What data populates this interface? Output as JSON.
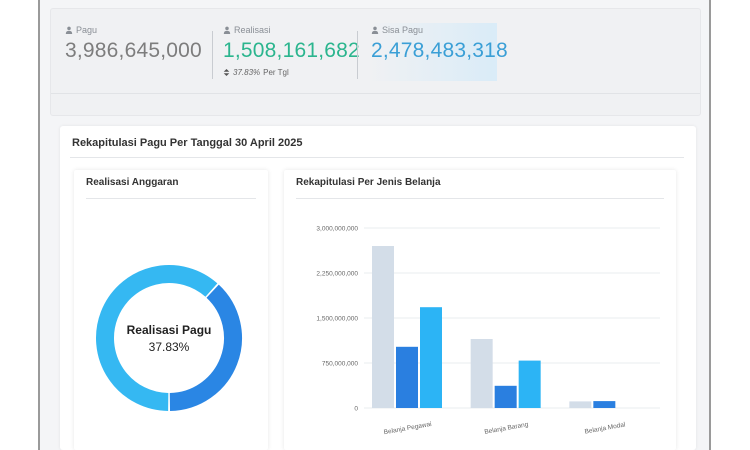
{
  "stats": {
    "pagu": {
      "label": "Pagu",
      "value": "3,986,645,000",
      "color": "#7d7d7d"
    },
    "realisasi": {
      "label": "Realisasi",
      "value": "1,508,161,682",
      "color": "#2bb58e",
      "sub_value": "37.83%",
      "sub_text": " Per Tgl"
    },
    "sisa": {
      "label": "Sisa Pagu",
      "value": "2,478,483,318",
      "color": "#3a9fd6"
    }
  },
  "main": {
    "title": "Rekapitulasi Pagu Per Tanggal 30 April 2025"
  },
  "donut_panel": {
    "title": "Realisasi Anggaran",
    "center_label": "Realisasi Pagu",
    "center_value": "37.83%",
    "percent": 37.83,
    "colors": {
      "realisasi": "#2a86e4",
      "sisa": "#35b8f2"
    }
  },
  "bar_panel": {
    "title": "Rekapitulasi Per Jenis Belanja"
  },
  "chart_data": {
    "type": "bar",
    "categories": [
      "Belanja Pegawai",
      "Belanja Barang",
      "Belanja Modal"
    ],
    "series": [
      {
        "values": [
          2700000000,
          1150000000,
          110000000
        ],
        "color": "#d3dde8"
      },
      {
        "values": [
          1020000000,
          370000000,
          115000000
        ],
        "color": "#2a7fe0"
      },
      {
        "values": [
          1680000000,
          790000000,
          0
        ],
        "color": "#2cb4f5"
      }
    ],
    "y_ticks": [
      "0",
      "750,000,000",
      "1,500,000,000",
      "2,250,000,000",
      "3,000,000,000"
    ],
    "ylim": [
      0,
      3000000000
    ],
    "grid": true
  }
}
